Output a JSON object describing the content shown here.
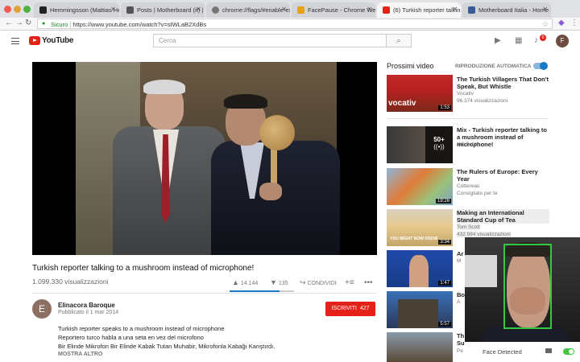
{
  "browser": {
    "tabs": [
      {
        "label": "Hemmingsson (Mattias He…",
        "icon_color": "#222222",
        "active": false
      },
      {
        "label": "Posts | Motherboard (it) | B…",
        "icon_color": "#555555",
        "active": false
      },
      {
        "label": "chrome://flags/#enable-exp…",
        "icon_color": "#777777",
        "active": false
      },
      {
        "label": "FacePause - Chrome Web S…",
        "icon_color": "#e8a11c",
        "active": false
      },
      {
        "label": "(6) Turkish reporter talkin…",
        "icon_color": "#e62117",
        "active": true
      },
      {
        "label": "Motherboard Italia - Home",
        "icon_color": "#3b5998",
        "active": false
      }
    ],
    "secure_label": "Sicuro",
    "url": "https://www.youtube.com/watch?v=sIWLaB2XdBs"
  },
  "youtube": {
    "logo_text": "YouTube",
    "search_placeholder": "Cerca",
    "notifications_count": "6",
    "avatar_letter": "F"
  },
  "video": {
    "title": "Turkish reporter talking to a mushroom instead of microphone!",
    "views": "1.099.330 visualizzazioni",
    "likes": "14.144",
    "dislikes": "135",
    "share_label": "CONDIVIDI",
    "like_ratio": 0.78
  },
  "channel": {
    "avatar_letter": "E",
    "name": "Elinacora Baroque",
    "published": "Pubblicato il 1 mar 2014",
    "subscribe_label": "ISCRIVITI",
    "subscribers": "427"
  },
  "description": {
    "lines": [
      "Turkish reporter speaks to a mushroom instead of microphone",
      "Reportero turco habla a una seta en vez del microfono",
      "Bir Elinde Mikrofon Bir Elinde Kabak Tutan Muhabir, Mikrofonla Kabağı Karıştırdı."
    ],
    "show_more": "MOSTRA ALTRO"
  },
  "sidebar": {
    "up_next": "Prossimi video",
    "autoplay_label": "RIPRODUZIONE AUTOMATICA",
    "videos": [
      {
        "title": "The Turkish Villagers That Don't Speak, But Whistle",
        "channel": "Vocativ",
        "views": "96.374 visualizzazioni",
        "duration": "1:53",
        "thumb_text": "vocativ"
      },
      {
        "title": "Mix - Turkish reporter talking to a mushroom instead of microphone!",
        "channel": "YouTube",
        "views": "",
        "duration": "",
        "thumb_text": "50+"
      },
      {
        "title": "The Rulers of Europe: Every Year",
        "channel": "Cottereau",
        "views": "Consigliato per te",
        "duration": "19:28",
        "thumb_text": ""
      },
      {
        "title": "Making an International Standard Cup of Tea",
        "channel": "Tom Scott",
        "views": "432.984 visualizzazioni",
        "duration": "3:34",
        "thumb_text": "YOU MIGHT NOW KNOW"
      },
      {
        "title": "Ar",
        "channel": "M",
        "views": "",
        "duration": "1:47",
        "thumb_text": ""
      },
      {
        "title": "Bo",
        "channel": "A",
        "views": "",
        "duration": "5:57",
        "thumb_text": ""
      },
      {
        "title": "Th Su",
        "channel": "Pe",
        "views": "",
        "duration": "",
        "thumb_text": ""
      }
    ]
  },
  "facepause": {
    "status": "Face Detected"
  }
}
